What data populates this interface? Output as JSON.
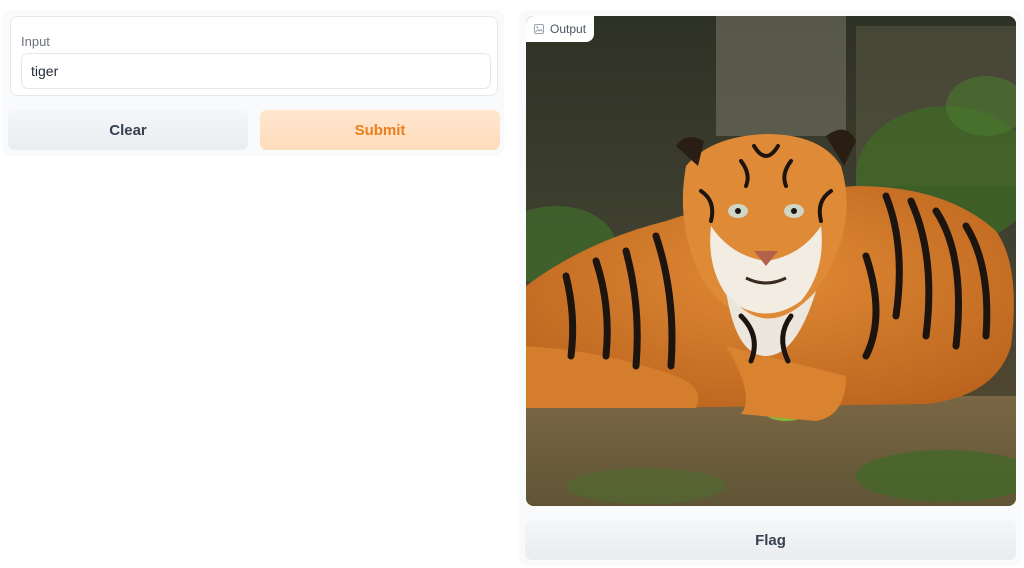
{
  "input": {
    "label": "Input",
    "value": "tiger"
  },
  "buttons": {
    "clear_label": "Clear",
    "submit_label": "Submit",
    "flag_label": "Flag"
  },
  "output": {
    "label": "Output",
    "icon": "image-icon"
  },
  "colors": {
    "submit_bg": "#ffe0c4",
    "submit_text": "#ea7f1b",
    "secondary_bg": "#eef0f3"
  }
}
